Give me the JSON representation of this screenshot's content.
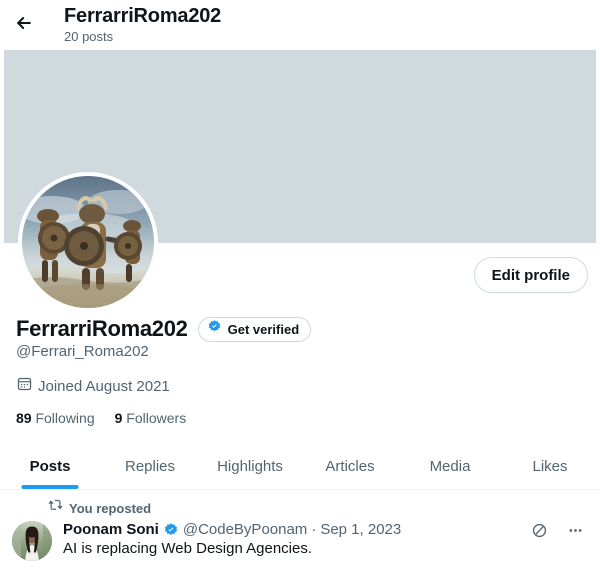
{
  "header": {
    "back_icon": "arrow-left-icon",
    "title": "FerrarriRoma202",
    "subtitle": "20 posts"
  },
  "banner": {
    "color": "#cfd9de"
  },
  "profile": {
    "avatar_icon": "viking-warriors-avatar",
    "edit_button_label": "Edit profile",
    "display_name": "FerrarriRoma202",
    "verified_badge_icon": "verified-badge-icon",
    "get_verified_label": "Get verified",
    "handle": "@Ferrari_Roma202",
    "joined_icon": "calendar-icon",
    "joined_text": "Joined August 2021",
    "following_count": "89",
    "following_label": "Following",
    "followers_count": "9",
    "followers_label": "Followers"
  },
  "tabs": [
    {
      "label": "Posts",
      "active": true
    },
    {
      "label": "Replies",
      "active": false
    },
    {
      "label": "Highlights",
      "active": false
    },
    {
      "label": "Articles",
      "active": false
    },
    {
      "label": "Media",
      "active": false
    },
    {
      "label": "Likes",
      "active": false
    }
  ],
  "post": {
    "repost_icon": "retweet-icon",
    "repost_label": "You reposted",
    "avatar_icon": "poonam-soni-avatar",
    "author": "Poonam Soni",
    "author_verified_icon": "verified-badge-icon",
    "handle": "@CodeByPoonam",
    "separator": "·",
    "date": "Sep 1, 2023",
    "text": "AI is replacing Web Design Agencies.",
    "grok_icon": "grok-slash-circle-icon",
    "more_icon": "more-horizontal-icon"
  },
  "colors": {
    "accent": "#1d9bf0",
    "text_primary": "#0f1419",
    "text_secondary": "#536471",
    "border": "#cfd9de",
    "banner": "#cfd9de"
  }
}
